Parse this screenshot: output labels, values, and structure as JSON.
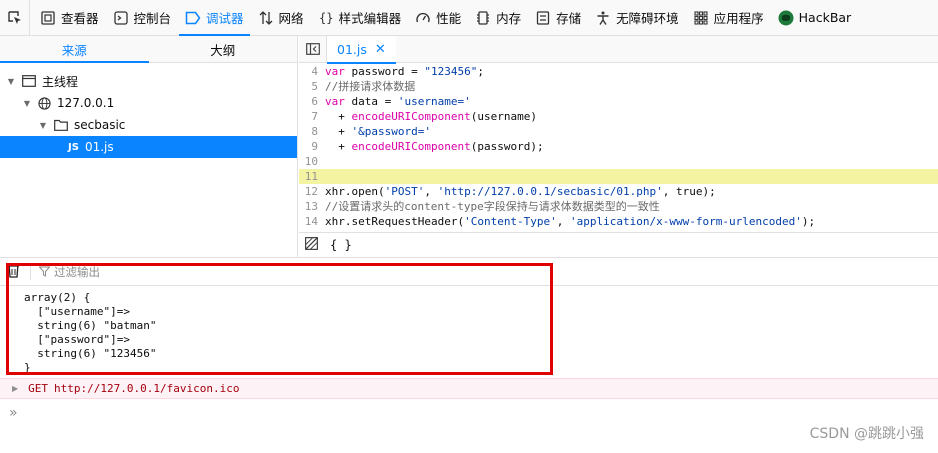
{
  "toolbar": {
    "tabs": [
      {
        "label": "查看器",
        "icon": "inspector-icon"
      },
      {
        "label": "控制台",
        "icon": "console-icon"
      },
      {
        "label": "调试器",
        "icon": "debugger-icon",
        "active": true
      },
      {
        "label": "网络",
        "icon": "network-icon"
      },
      {
        "label": "样式编辑器",
        "icon": "style-editor-icon"
      },
      {
        "label": "性能",
        "icon": "performance-icon"
      },
      {
        "label": "内存",
        "icon": "memory-icon"
      },
      {
        "label": "存储",
        "icon": "storage-icon"
      },
      {
        "label": "无障碍环境",
        "icon": "accessibility-icon"
      },
      {
        "label": "应用程序",
        "icon": "application-icon"
      },
      {
        "label": "HackBar",
        "icon": "hackbar-icon"
      }
    ]
  },
  "sources": {
    "tabs": [
      "来源",
      "大纲"
    ],
    "tree": [
      {
        "label": "主线程",
        "icon": "window-icon"
      },
      {
        "label": "127.0.0.1",
        "icon": "globe-icon"
      },
      {
        "label": "secbasic",
        "icon": "folder-icon"
      },
      {
        "label": "01.js",
        "icon_text": "JS"
      }
    ]
  },
  "editor": {
    "file_tab": "01.js",
    "close_glyph": "✕",
    "braces_label": "{ }",
    "lines": [
      {
        "n": "4",
        "parts": [
          [
            "k",
            "var"
          ],
          [
            "t",
            " password = "
          ],
          [
            "s",
            "\"123456\""
          ],
          [
            "t",
            ";"
          ]
        ]
      },
      {
        "n": "5",
        "parts": [
          [
            "c",
            "//拼接请求体数据"
          ]
        ]
      },
      {
        "n": "6",
        "parts": [
          [
            "k",
            "var"
          ],
          [
            "t",
            " data = "
          ],
          [
            "s",
            "'username='"
          ]
        ]
      },
      {
        "n": "7",
        "parts": [
          [
            "t",
            "  + "
          ],
          [
            "f",
            "encodeURIComponent"
          ],
          [
            "t",
            "(username)"
          ]
        ]
      },
      {
        "n": "8",
        "parts": [
          [
            "t",
            "  + "
          ],
          [
            "s",
            "'&password='"
          ]
        ]
      },
      {
        "n": "9",
        "parts": [
          [
            "t",
            "  + "
          ],
          [
            "f",
            "encodeURIComponent"
          ],
          [
            "t",
            "(password);"
          ]
        ]
      },
      {
        "n": "10",
        "parts": []
      },
      {
        "n": "11",
        "parts": [],
        "highlight": true
      },
      {
        "n": "12",
        "parts": [
          [
            "t",
            "xhr.open("
          ],
          [
            "s",
            "'POST'"
          ],
          [
            "t",
            ", "
          ],
          [
            "s",
            "'http://127.0.0.1/secbasic/01.php'"
          ],
          [
            "t",
            ", true);"
          ]
        ]
      },
      {
        "n": "13",
        "parts": [
          [
            "c",
            "//设置请求头的content-type字段保持与请求体数据类型的一致性"
          ]
        ]
      },
      {
        "n": "14",
        "parts": [
          [
            "t",
            "xhr.setRequestHeader("
          ],
          [
            "s",
            "'Content-Type'"
          ],
          [
            "t",
            ", "
          ],
          [
            "s",
            "'application/x-www-form-urlencoded'"
          ],
          [
            "t",
            ");"
          ]
        ]
      }
    ]
  },
  "console": {
    "filter_placeholder": "过滤输出",
    "output": "array(2) {\n  [\"username\"]=>\n  string(6) \"batman\"\n  [\"password\"]=>\n  string(6) \"123456\"\n}",
    "error_method": "GET",
    "error_url": "http://127.0.0.1/favicon.ico",
    "prompt_glyph": "»"
  },
  "watermark": "CSDN @跳跳小强",
  "colors": {
    "accent": "#0a84ff",
    "annotation_box": "#e00000",
    "line_highlight": "#f3f3a2"
  }
}
